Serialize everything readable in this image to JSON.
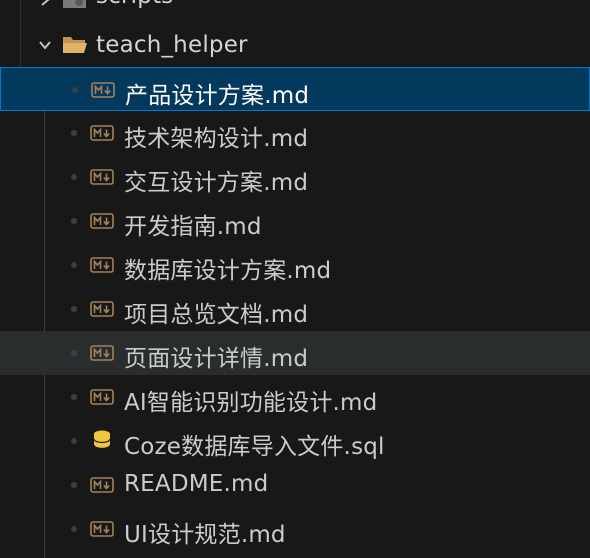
{
  "explorer": {
    "partial_folder": {
      "label": "scripts",
      "icon": "folder-gear-icon"
    },
    "folder": {
      "label": "teach_helper",
      "icon": "folder-open-icon",
      "expanded": true
    },
    "files": [
      {
        "label": "产品设计方案.md",
        "icon": "markdown-icon",
        "state": "selected"
      },
      {
        "label": "技术架构设计.md",
        "icon": "markdown-icon",
        "state": ""
      },
      {
        "label": "交互设计方案.md",
        "icon": "markdown-icon",
        "state": ""
      },
      {
        "label": "开发指南.md",
        "icon": "markdown-icon",
        "state": ""
      },
      {
        "label": "数据库设计方案.md",
        "icon": "markdown-icon",
        "state": ""
      },
      {
        "label": "项目总览文档.md",
        "icon": "markdown-icon",
        "state": ""
      },
      {
        "label": "页面设计详情.md",
        "icon": "markdown-icon",
        "state": "hovered"
      },
      {
        "label": "AI智能识别功能设计.md",
        "icon": "markdown-icon",
        "state": ""
      },
      {
        "label": "Coze数据库导入文件.sql",
        "icon": "database-icon",
        "state": ""
      },
      {
        "label": "README.md",
        "icon": "markdown-icon",
        "state": ""
      },
      {
        "label": "UI设计规范.md",
        "icon": "markdown-icon",
        "state": ""
      }
    ],
    "colors": {
      "background": "#181818",
      "selected_background": "#04395e",
      "selected_border": "#0078d4",
      "hover_background": "#2a2d2e",
      "markdown_icon": "#a6805a",
      "database_icon": "#f0c63c",
      "folder_icon": "#c09553"
    }
  }
}
